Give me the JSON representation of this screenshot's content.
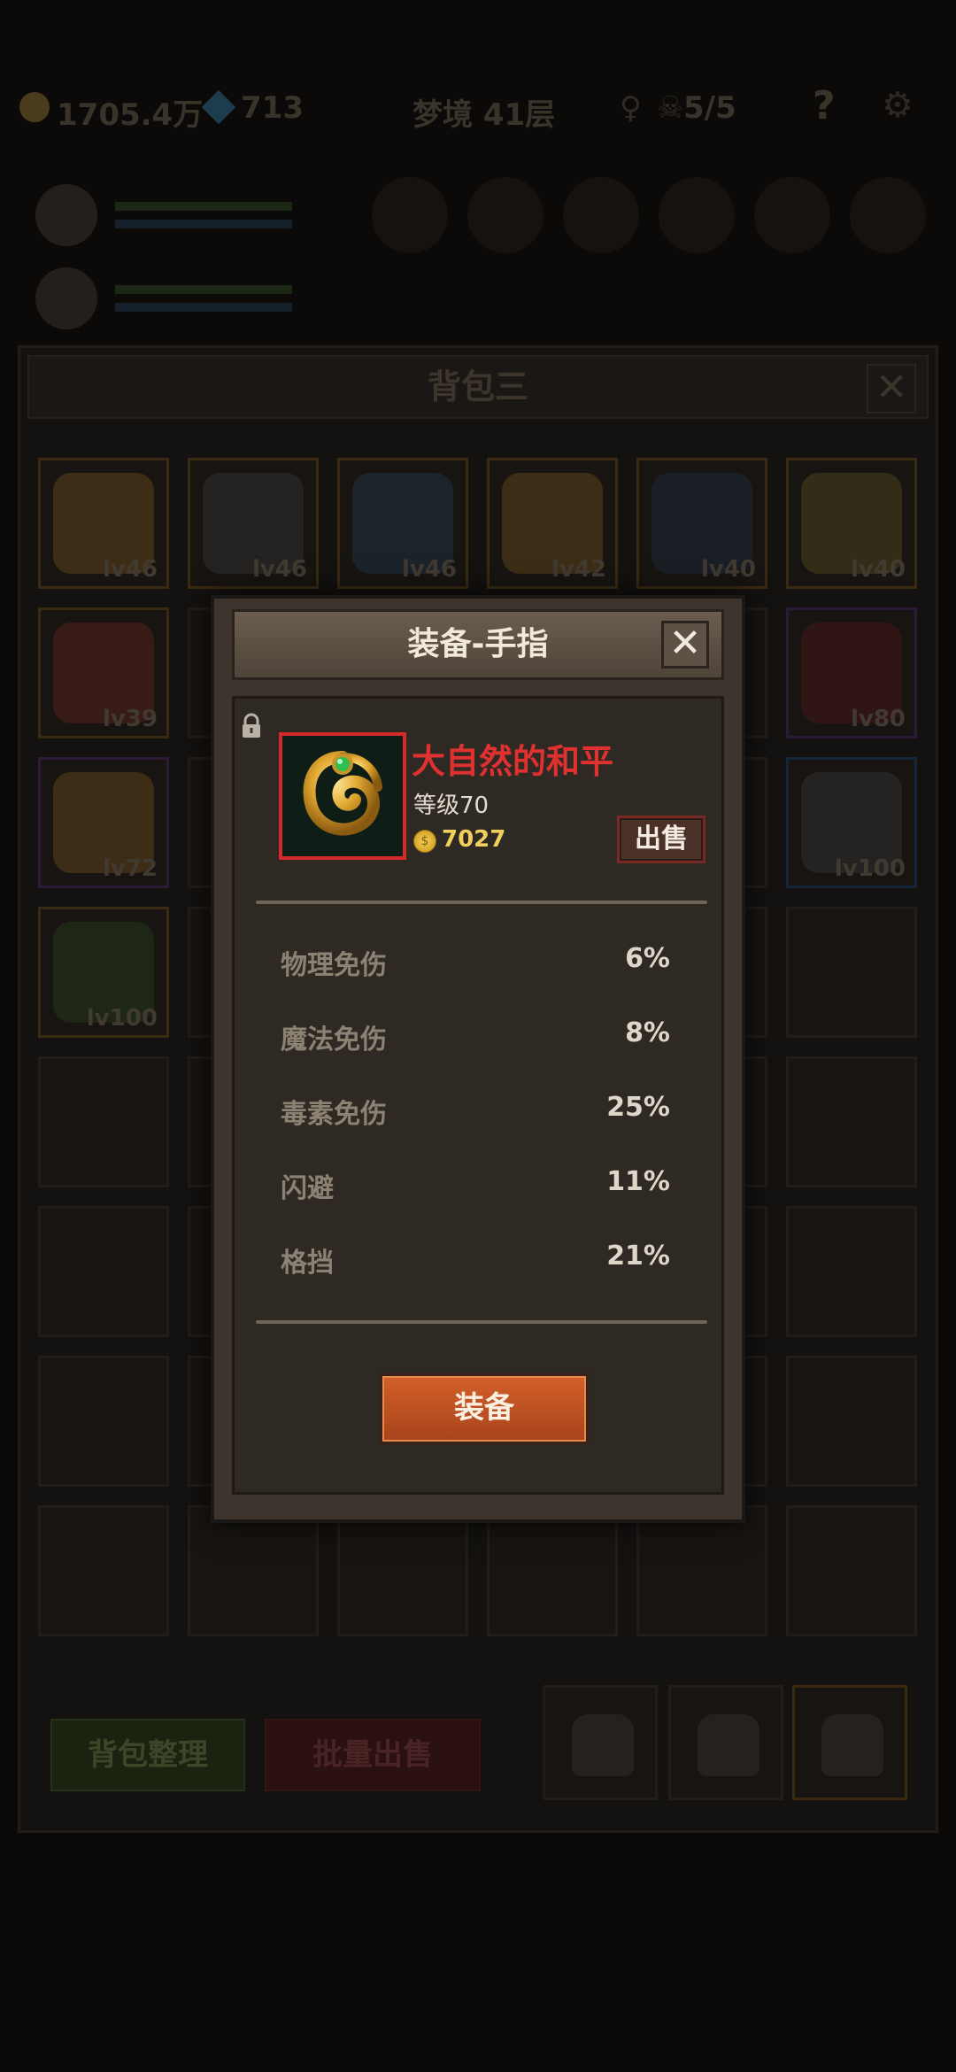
{
  "topbar": {
    "gold": "1705.4万",
    "gems": "713",
    "stage": "梦境 41层",
    "keys": "5/5",
    "help": "?"
  },
  "bag": {
    "title": "背包三",
    "close": "✕",
    "items": [
      {
        "level": "lv46",
        "rarity": "orange",
        "icon": "gold-ring-icon",
        "color": "#c98a2a"
      },
      {
        "level": "lv46",
        "rarity": "orange",
        "icon": "helmet-icon",
        "color": "#555960"
      },
      {
        "level": "lv46",
        "rarity": "orange",
        "icon": "blue-shield-icon",
        "color": "#2d5a8a"
      },
      {
        "level": "lv42",
        "rarity": "orange",
        "icon": "gold-ring-icon",
        "color": "#c98a2a"
      },
      {
        "level": "lv40",
        "rarity": "orange",
        "icon": "blue-armor-icon",
        "color": "#2a4a70"
      },
      {
        "level": "lv40",
        "rarity": "orange",
        "icon": "round-shield-icon",
        "color": "#9a8a30"
      },
      {
        "level": "lv39",
        "rarity": "orange",
        "icon": "ruby-ring-icon",
        "color": "#b0342a"
      },
      {
        "level": "lv80",
        "rarity": "purple",
        "icon": "amulet-icon",
        "color": "#8a1a20"
      },
      {
        "level": "lv72",
        "rarity": "purple",
        "icon": "gold-ring-icon",
        "color": "#c98a2a"
      },
      {
        "level": "lv100",
        "rarity": "blue",
        "icon": "knight-helmet-icon",
        "color": "#555960"
      },
      {
        "level": "lv100",
        "rarity": "orange",
        "icon": "gun-icon",
        "color": "#3a6a2a"
      }
    ],
    "sort_label": "背包整理",
    "bulk_sell_label": "批量出售"
  },
  "modal": {
    "title": "装备-手指",
    "close": "✕",
    "item_name": "大自然的和平",
    "item_level": "等级70",
    "coin_symbol": "$",
    "price": "7027",
    "sell_label": "出售",
    "stats": [
      {
        "name": "物理免伤",
        "value": "6%"
      },
      {
        "name": "魔法免伤",
        "value": "8%"
      },
      {
        "name": "毒素免伤",
        "value": "25%"
      },
      {
        "name": "闪避",
        "value": "11%"
      },
      {
        "name": "格挡",
        "value": "21%"
      }
    ],
    "equip_label": "装备"
  }
}
